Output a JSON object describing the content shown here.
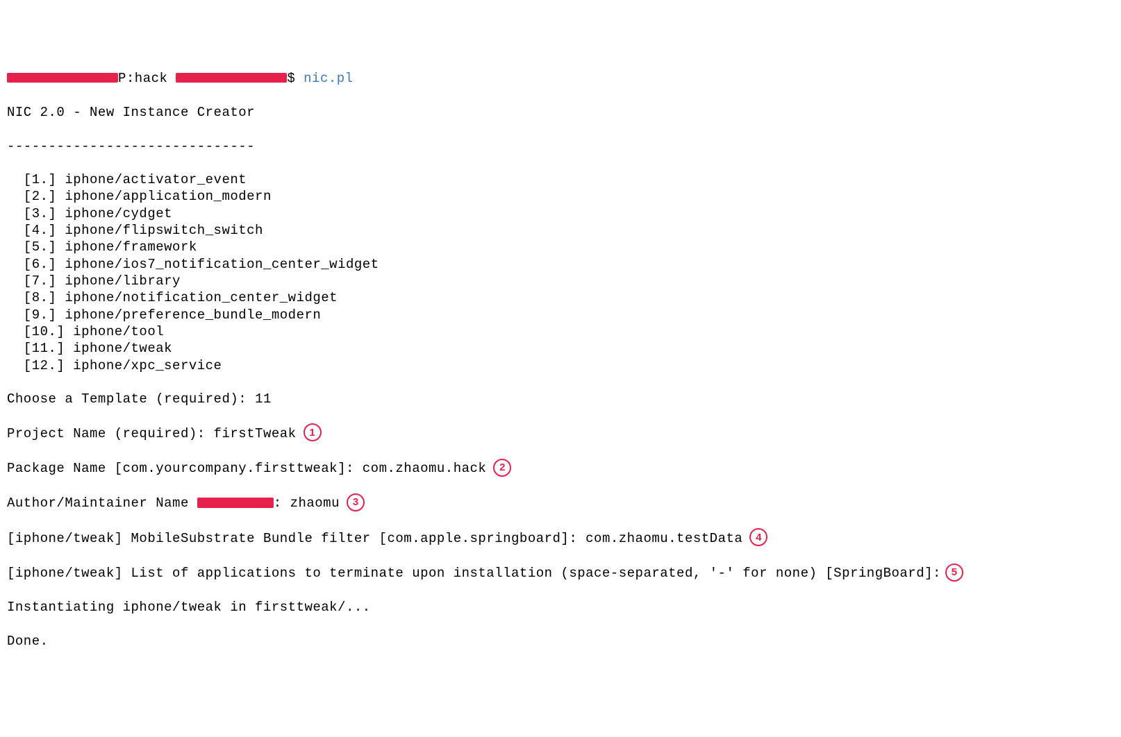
{
  "prompt": {
    "pre": "P:hack ",
    "post": "$ ",
    "command": "nic.pl"
  },
  "header": "NIC 2.0 - New Instance Creator",
  "divider": "------------------------------",
  "templates": [
    {
      "num": "1.",
      "name": "iphone/activator_event"
    },
    {
      "num": "2.",
      "name": "iphone/application_modern"
    },
    {
      "num": "3.",
      "name": "iphone/cydget"
    },
    {
      "num": "4.",
      "name": "iphone/flipswitch_switch"
    },
    {
      "num": "5.",
      "name": "iphone/framework"
    },
    {
      "num": "6.",
      "name": "iphone/ios7_notification_center_widget"
    },
    {
      "num": "7.",
      "name": "iphone/library"
    },
    {
      "num": "8.",
      "name": "iphone/notification_center_widget"
    },
    {
      "num": "9.",
      "name": "iphone/preference_bundle_modern"
    },
    {
      "num": "10.",
      "name": "iphone/tool"
    },
    {
      "num": "11.",
      "name": "iphone/tweak"
    },
    {
      "num": "12.",
      "name": "iphone/xpc_service"
    }
  ],
  "q": {
    "choose_label": "Choose a Template (required): ",
    "choose_value": "11",
    "proj_label": "Project Name (required): ",
    "proj_value": "firstTweak",
    "pkg_label": "Package Name [com.yourcompany.firsttweak]: ",
    "pkg_value": "com.zhaomu.hack",
    "author_label": "Author/Maintainer Name ",
    "author_sep": ": ",
    "author_value": "zhaomu",
    "filter_label": "[iphone/tweak] MobileSubstrate Bundle filter [com.apple.springboard]: ",
    "filter_value": "com.zhaomu.testData",
    "termlist": "[iphone/tweak] List of applications to terminate upon installation (space-separated, '-' for none) [SpringBoard]:",
    "inst": "Instantiating iphone/tweak in firsttweak/...",
    "done": "Done."
  },
  "annotations": {
    "a1": "1",
    "a2": "2",
    "a3": "3",
    "a4": "4",
    "a5": "5"
  }
}
